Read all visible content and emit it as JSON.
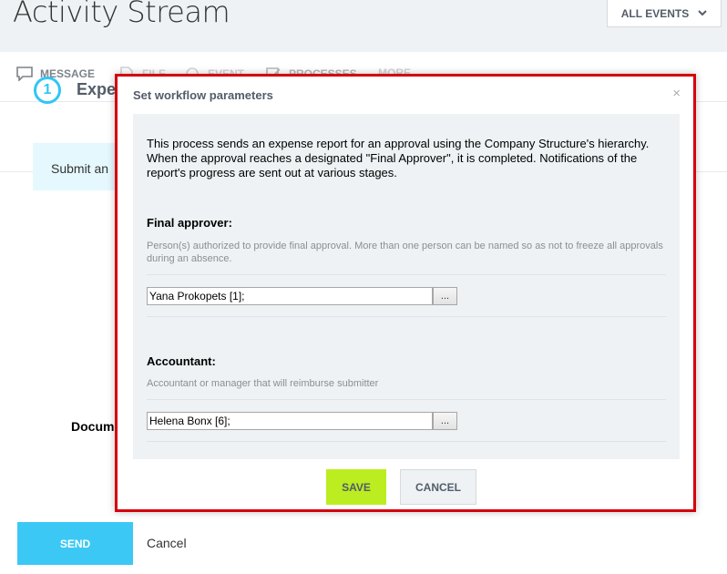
{
  "page": {
    "title": "Activity Stream"
  },
  "filter": {
    "label": "ALL EVENTS"
  },
  "tabs": [
    {
      "label": "MESSAGE",
      "icon": "message-icon"
    },
    {
      "label": "FILE",
      "icon": "file-icon"
    },
    {
      "label": "EVENT",
      "icon": "event-icon"
    },
    {
      "label": "PROCESSES",
      "icon": "processes-icon"
    },
    {
      "label": "MORE",
      "icon": ""
    }
  ],
  "process": {
    "step": "1",
    "title": "Expe",
    "submit_text": "Submit an",
    "document_label": "Docum"
  },
  "footer": {
    "send_label": "SEND",
    "cancel_label": "Cancel"
  },
  "dialog": {
    "title": "Set workflow parameters",
    "close": "×",
    "description": "This process sends an expense report for an approval using the Company Structure's hierarchy. When the approval reaches a designated \"Final Approver\", it is completed. Notifications of the report's progress are sent out at various stages.",
    "fields": [
      {
        "title": "Final approver:",
        "hint": "Person(s) authorized to provide final approval. More than one person can be named so as not to freeze all approvals during an absence.",
        "value": "Yana Prokopets [1];",
        "picker_label": "..."
      },
      {
        "title": "Accountant:",
        "hint": "Accountant or manager that will reimburse submitter",
        "value": "Helena Bonx [6];",
        "picker_label": "..."
      }
    ],
    "save_label": "SAVE",
    "cancel_label": "CANCEL"
  },
  "colors": {
    "accent_blue": "#3bc8f5",
    "save_green": "#bbed21",
    "highlight_red": "#d4000e"
  }
}
